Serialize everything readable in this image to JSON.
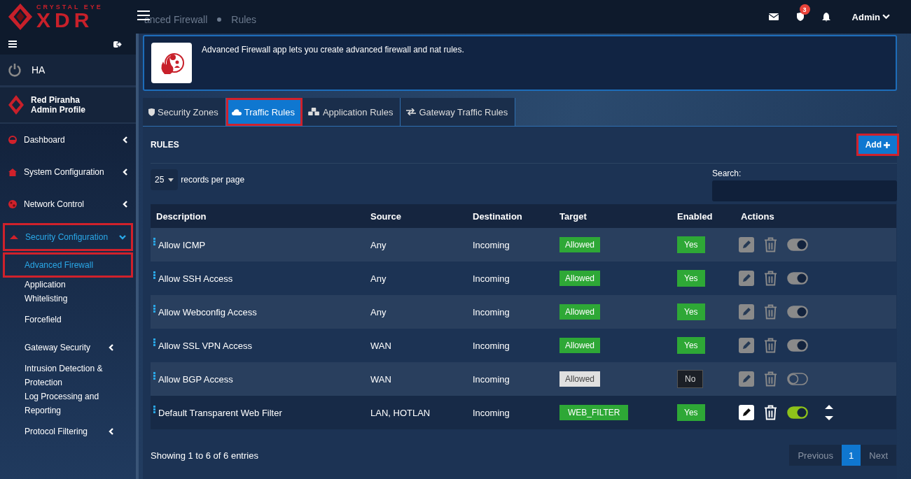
{
  "header": {
    "logo_top": "CRYSTAL EYE",
    "logo_main": "XDR",
    "breadcrumb": [
      "anced Firewall",
      "Rules"
    ],
    "notification_count": "3",
    "user": "Admin"
  },
  "sidebar": {
    "ha": "HA",
    "profile_name": "Red Piranha",
    "profile_role": "Admin Profile",
    "items": [
      {
        "label": "Dashboard",
        "expanded": false,
        "selected": false,
        "highlighted": false
      },
      {
        "label": "System Configuration",
        "expanded": false,
        "selected": false,
        "highlighted": false
      },
      {
        "label": "Network Control",
        "expanded": false,
        "selected": false,
        "highlighted": false
      },
      {
        "label": "Security Configuration",
        "expanded": true,
        "selected": true,
        "highlighted": true,
        "children": [
          {
            "label": "Advanced Firewall",
            "selected": true,
            "highlighted": true,
            "has_submenu": false
          },
          {
            "label": "Application Whitelisting",
            "selected": false,
            "highlighted": false,
            "has_submenu": false
          },
          {
            "label": "Forcefield",
            "selected": false,
            "highlighted": false,
            "has_submenu": false
          },
          {
            "label": "Gateway Security",
            "selected": false,
            "highlighted": false,
            "has_submenu": true
          },
          {
            "label": "Intrusion Detection & Protection",
            "selected": false,
            "highlighted": false,
            "has_submenu": false
          },
          {
            "label": "Log Processing and Reporting",
            "selected": false,
            "highlighted": false,
            "has_submenu": false
          },
          {
            "label": "Protocol Filtering",
            "selected": false,
            "highlighted": false,
            "has_submenu": true
          }
        ]
      }
    ]
  },
  "app_info": {
    "description": "Advanced Firewall app lets you create advanced firewall and nat rules."
  },
  "tabs": [
    {
      "label": "Security Zones",
      "selected": false,
      "highlighted": false
    },
    {
      "label": "Traffic Rules",
      "selected": true,
      "highlighted": true
    },
    {
      "label": "Application Rules",
      "selected": false,
      "highlighted": false
    },
    {
      "label": "Gateway Traffic Rules",
      "selected": false,
      "highlighted": false
    }
  ],
  "panel": {
    "title": "RULES",
    "add_button": {
      "label": "Add",
      "highlighted": true
    },
    "page_size": "25",
    "page_size_label": "records per page",
    "search_label": "Search:",
    "columns": [
      "Description",
      "Source",
      "Destination",
      "Target",
      "Enabled",
      "Actions"
    ],
    "rows": [
      {
        "description": "Allow ICMP",
        "source": "Any",
        "destination": "Incoming",
        "target": "Allowed",
        "enabled": "Yes",
        "on": true,
        "selected": false
      },
      {
        "description": "Allow SSH Access",
        "source": "Any",
        "destination": "Incoming",
        "target": "Allowed",
        "enabled": "Yes",
        "on": true,
        "selected": false
      },
      {
        "description": "Allow Webconfig Access",
        "source": "Any",
        "destination": "Incoming",
        "target": "Allowed",
        "enabled": "Yes",
        "on": true,
        "selected": false
      },
      {
        "description": "Allow SSL VPN Access",
        "source": "WAN",
        "destination": "Incoming",
        "target": "Allowed",
        "enabled": "Yes",
        "on": true,
        "selected": false
      },
      {
        "description": "Allow BGP Access",
        "source": "WAN",
        "destination": "Incoming",
        "target": "Allowed",
        "enabled": "No",
        "on": false,
        "selected": false
      },
      {
        "description": "Default Transparent Web Filter",
        "source": "LAN, HOTLAN",
        "destination": "Incoming",
        "target": "WEB_FILTER",
        "enabled": "Yes",
        "on": true,
        "selected": true
      }
    ],
    "summary": "Showing 1 to 6 of 6 entries",
    "pagination": [
      {
        "label": "Previous",
        "kind": "nav",
        "selected": false
      },
      {
        "label": "1",
        "kind": "page",
        "selected": true
      },
      {
        "label": "Next",
        "kind": "nav",
        "selected": false
      }
    ]
  }
}
